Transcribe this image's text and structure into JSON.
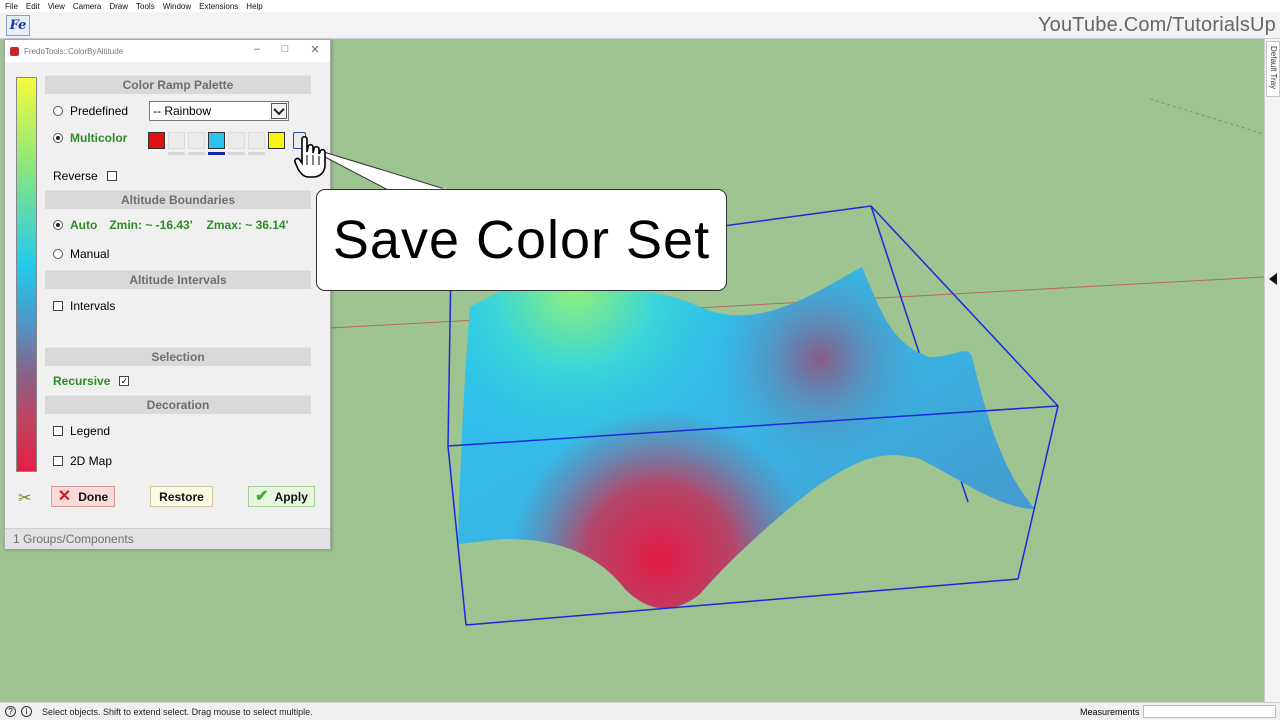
{
  "menu": [
    "File",
    "Edit",
    "View",
    "Camera",
    "Draw",
    "Tools",
    "Window",
    "Extensions",
    "Help"
  ],
  "toolbar": {
    "plugin_button": "Fe"
  },
  "watermark": "YouTube.Com/TutorialsUp",
  "tray": {
    "tab_label": "Default Tray"
  },
  "dialog": {
    "title": "FredoTools::ColorByAltitude",
    "sections": {
      "palette": "Color Ramp Palette",
      "boundaries": "Altitude Boundaries",
      "intervals": "Altitude Intervals",
      "selection": "Selection",
      "decoration": "Decoration"
    },
    "predefined_label": "Predefined",
    "predefined_value": "-- Rainbow",
    "multicolor_label": "Multicolor",
    "swatches": [
      "#e01010",
      "",
      "",
      "#2bc3ee",
      "",
      "",
      "#f5f510"
    ],
    "reverse_label": "Reverse",
    "auto_label": "Auto",
    "zmin_text": "Zmin: ~ -16.43'",
    "zmax_text": "Zmax: ~ 36.14'",
    "manual_label": "Manual",
    "intervals_label": "Intervals",
    "recursive_label": "Recursive",
    "legend_label": "Legend",
    "map2d_label": "2D Map",
    "done_label": "Done",
    "restore_label": "Restore",
    "apply_label": "Apply",
    "footer": "1 Groups/Components"
  },
  "callout": "Save Color Set",
  "status": {
    "hint": "Select objects. Shift to extend select. Drag mouse to select multiple.",
    "measurements_label": "Measurements"
  }
}
